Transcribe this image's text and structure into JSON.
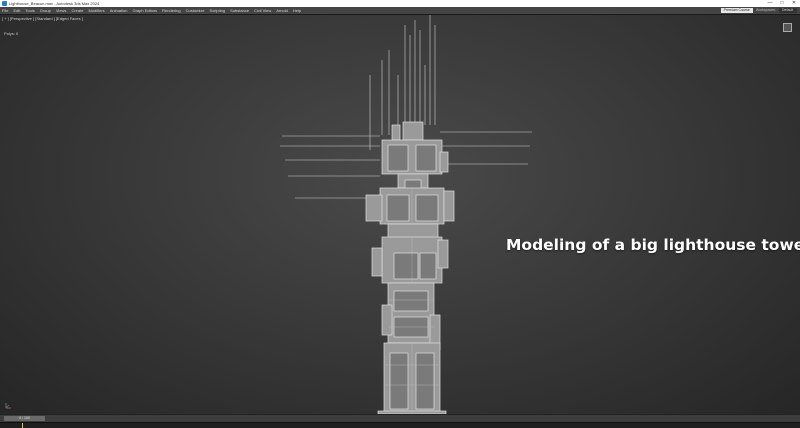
{
  "window": {
    "title": "Lighthouse_Beacon.max - Autodesk 3ds Max 2024",
    "controls": {
      "minimize": "—",
      "maximize": "□",
      "close": "✕"
    }
  },
  "menu": {
    "items": [
      "File",
      "Edit",
      "Tools",
      "Group",
      "Views",
      "Create",
      "Modifiers",
      "Animation",
      "Graph Editors",
      "Rendering",
      "Customize",
      "Scripting",
      "Substance",
      "Civil View",
      "Arnold",
      "Help"
    ],
    "premiere_button": "Premium Course",
    "workspaces_label": "Workspaces:",
    "workspaces_value": "Default"
  },
  "viewport": {
    "label": "[ + ] [Perspective ] [Standard ] [Edged Faces ]",
    "poly_stat": "Polys:    0",
    "caption": "Modeling of a big lighthouse tower"
  },
  "timeline": {
    "slider_text": "0 / 100"
  },
  "colors": {
    "viewport_bg": "#3a3a3a",
    "menu_bg": "#444444",
    "caption": "#ffffff",
    "frame_marker": "#e8c040"
  }
}
